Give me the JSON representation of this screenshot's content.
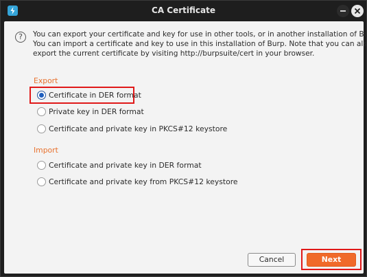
{
  "window": {
    "title": "CA Certificate"
  },
  "description": [
    "You can export your certificate and key for use in other tools, or in another installation of Burp.",
    "You can import a certificate and key to use in this installation of Burp. Note that you can also",
    "export the current certificate by visiting http://burpsuite/cert in your browser."
  ],
  "export": {
    "heading": "Export",
    "options": [
      {
        "label": "Certificate in DER format",
        "selected": true
      },
      {
        "label": "Private key in DER format",
        "selected": false
      },
      {
        "label": "Certificate and private key in PKCS#12 keystore",
        "selected": false
      }
    ]
  },
  "import": {
    "heading": "Import",
    "options": [
      {
        "label": "Certificate and private key in DER format",
        "selected": false
      },
      {
        "label": "Certificate and private key from PKCS#12 keystore",
        "selected": false
      }
    ]
  },
  "buttons": {
    "cancel": "Cancel",
    "next": "Next"
  },
  "colors": {
    "accent": "#f06a2a",
    "section_heading": "#e8712d",
    "highlight": "#e01818",
    "app_icon": "#34a4d8"
  }
}
